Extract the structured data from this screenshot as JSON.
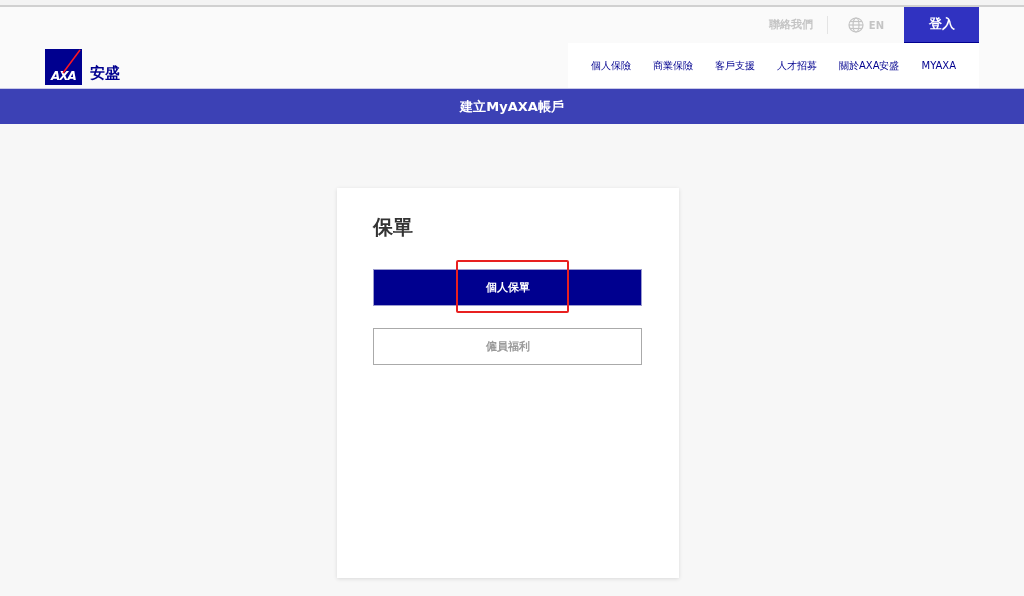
{
  "header": {
    "logo": {
      "mark": "AXA",
      "brand": "安盛"
    },
    "utility": {
      "contact": "聯絡我們",
      "language": "EN",
      "login": "登入"
    },
    "nav": [
      {
        "label": "個人保險"
      },
      {
        "label": "商業保險"
      },
      {
        "label": "客戶支援"
      },
      {
        "label": "人才招募"
      },
      {
        "label": "關於AXA安盛"
      },
      {
        "label": "MYAXA"
      }
    ]
  },
  "banner": {
    "title": "建立MyAXA帳戶"
  },
  "card": {
    "title": "保單",
    "options": [
      {
        "label": "個人保單",
        "selected": true,
        "highlighted": true
      },
      {
        "label": "僱員福利",
        "selected": false,
        "highlighted": false
      }
    ]
  }
}
